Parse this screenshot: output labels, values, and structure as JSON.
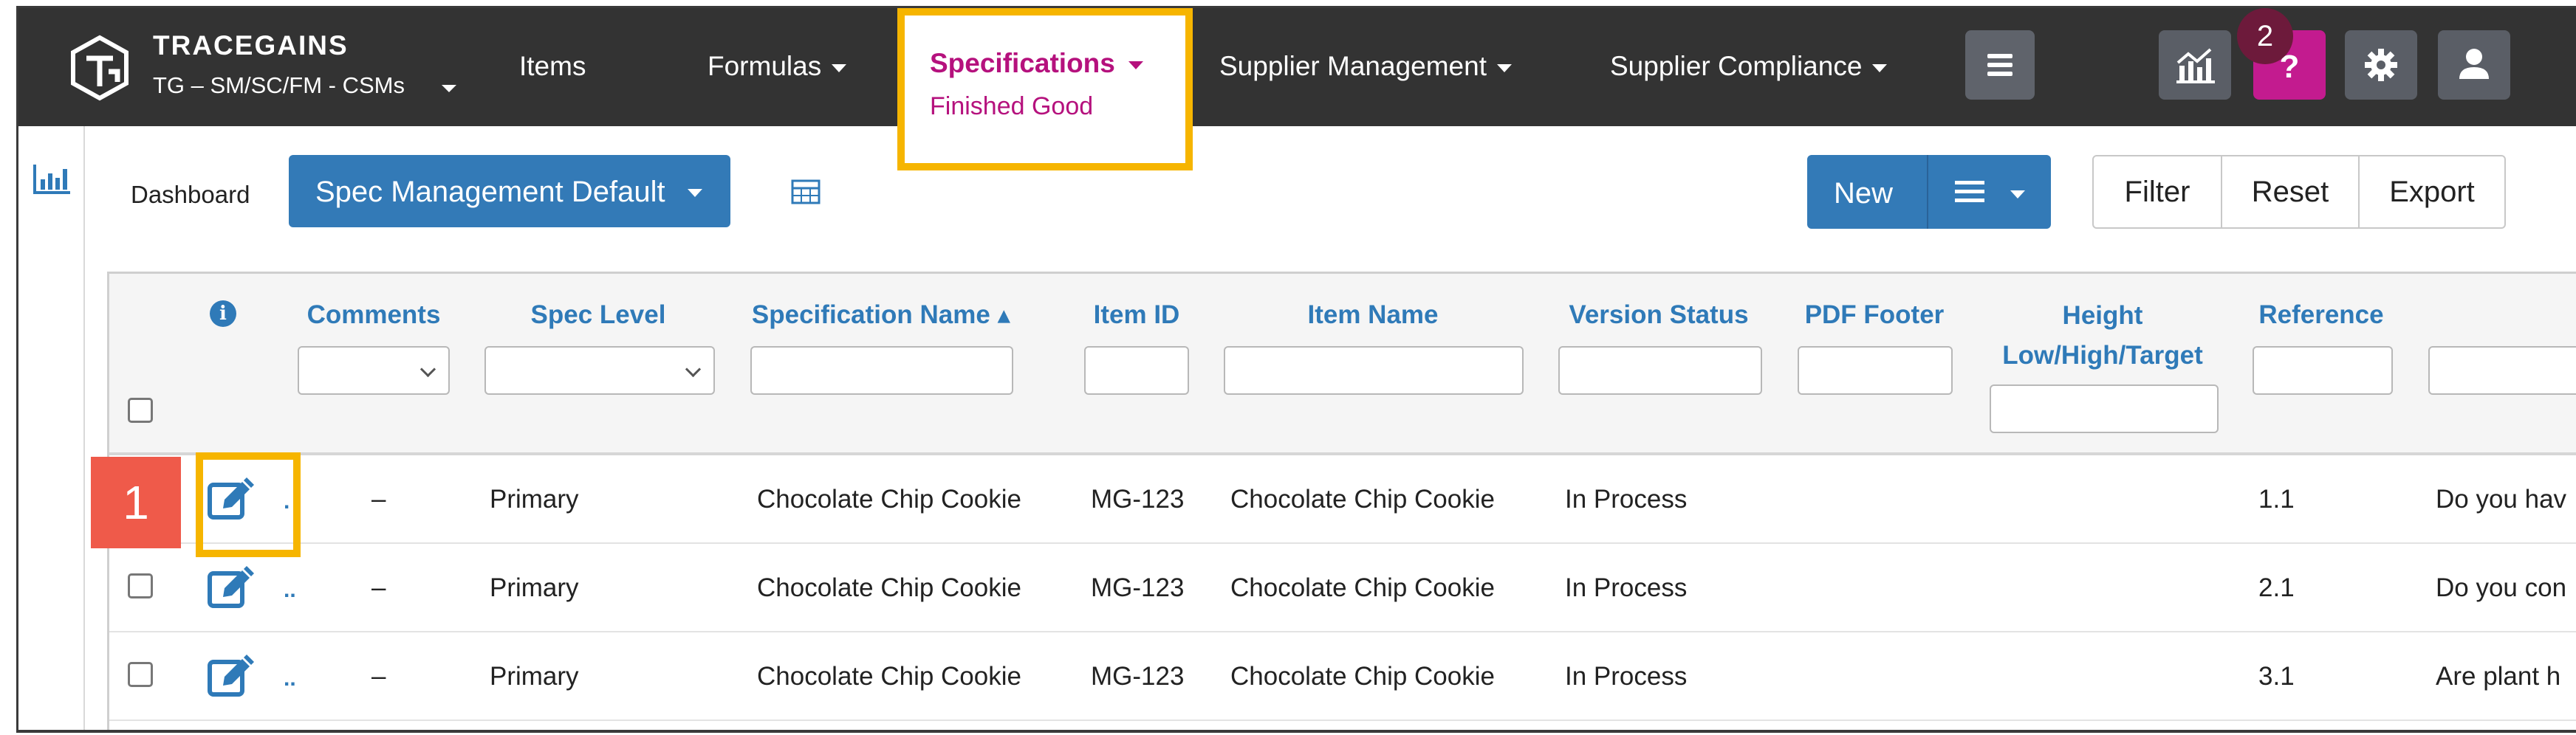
{
  "header": {
    "brand_name": "TRACEGAINS",
    "brand_org": "TG – SM/SC/FM - CSMs",
    "nav": {
      "items": "Items",
      "formulas": "Formulas",
      "specifications": "Specifications",
      "specifications_sub": "Finished Good",
      "supplier_management": "Supplier Management",
      "supplier_compliance": "Supplier Compliance"
    },
    "help_badge": "2"
  },
  "toolbar": {
    "dashboard_label": "Dashboard",
    "view_selector": "Spec Management Default",
    "new_label": "New",
    "filter_label": "Filter",
    "reset_label": "Reset",
    "export_label": "Export"
  },
  "table": {
    "info_glyph": "i",
    "columns": {
      "comments": "Comments",
      "spec_level": "Spec Level",
      "spec_name": "Specification Name ▴",
      "item_id": "Item ID",
      "item_name": "Item Name",
      "version_status": "Version Status",
      "pdf_footer": "PDF Footer",
      "height": "Height Low/High/Target",
      "reference": "Reference"
    },
    "rows": [
      {
        "dots": ".",
        "comments": "–",
        "spec_level": "Primary",
        "spec_name": "Chocolate Chip Cookie",
        "item_id": "MG-123",
        "item_name": "Chocolate Chip Cookie",
        "version_status": "In Process",
        "reference": "1.1",
        "question": "Do you hav"
      },
      {
        "dots": "..",
        "comments": "–",
        "spec_level": "Primary",
        "spec_name": "Chocolate Chip Cookie",
        "item_id": "MG-123",
        "item_name": "Chocolate Chip Cookie",
        "version_status": "In Process",
        "reference": "2.1",
        "question": "Do you con"
      },
      {
        "dots": "..",
        "comments": "–",
        "spec_level": "Primary",
        "spec_name": "Chocolate Chip Cookie",
        "item_id": "MG-123",
        "item_name": "Chocolate Chip Cookie",
        "version_status": "In Process",
        "reference": "3.1",
        "question": "Are plant h"
      }
    ]
  },
  "annotation": {
    "step_number": "1"
  },
  "colors": {
    "nav_bg": "#333333",
    "accent_magenta": "#b5117d",
    "primary_blue": "#337ab7",
    "highlight_yellow": "#f6b500",
    "step_red": "#ef5a4a"
  }
}
